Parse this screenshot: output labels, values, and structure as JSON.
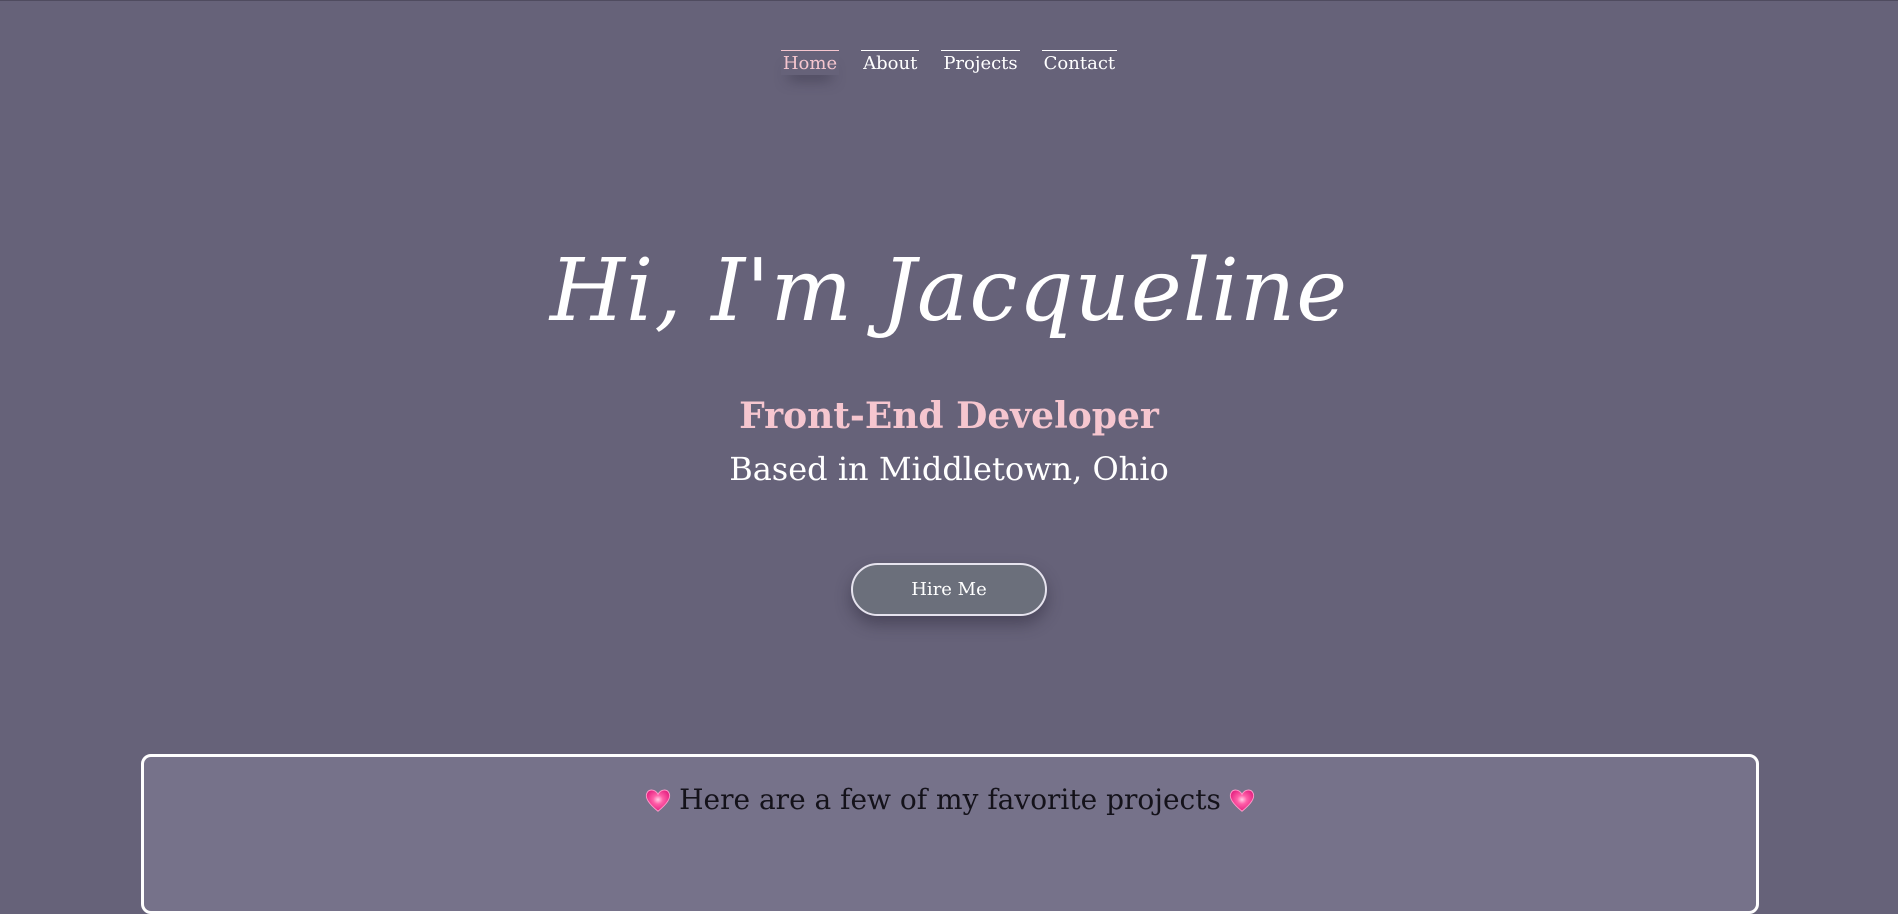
{
  "nav": {
    "items": [
      {
        "label": "Home",
        "active": true
      },
      {
        "label": "About",
        "active": false
      },
      {
        "label": "Projects",
        "active": false
      },
      {
        "label": "Contact",
        "active": false
      }
    ]
  },
  "hero": {
    "title": "Hi, I'm Jacqueline",
    "role": "Front-End Developer",
    "location": "Based in Middletown, Ohio",
    "cta_label": "Hire Me"
  },
  "projects": {
    "heading": "Here are a few of my favorite projects",
    "heading_icon": "heart-icon"
  },
  "colors": {
    "background": "#666279",
    "accent_pink": "#f6c6cf",
    "text_white": "#ffffff",
    "button_bg": "#6b6f7b",
    "projects_bg": "#76728a",
    "heart": "#ff4f9a"
  }
}
